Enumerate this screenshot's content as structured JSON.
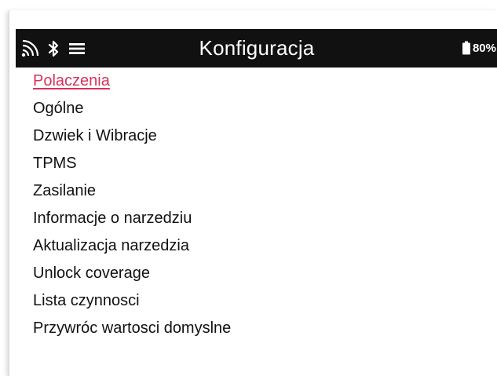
{
  "app": {
    "title": "Konfiguracja"
  },
  "status_bar": {
    "icons": [
      "signal-icon",
      "bluetooth-icon",
      "menu-icon"
    ],
    "battery_label": "80%",
    "battery_level_percent": 80
  },
  "menu": {
    "selected_index": 0,
    "items": [
      {
        "label": "Polaczenia"
      },
      {
        "label": "Ogólne"
      },
      {
        "label": "Dzwiek i Wibracje"
      },
      {
        "label": "TPMS"
      },
      {
        "label": "Zasilanie"
      },
      {
        "label": "Informacje o narzedziu"
      },
      {
        "label": "Aktualizacja narzedzia"
      },
      {
        "label": "Unlock coverage"
      },
      {
        "label": "Lista czynnosci"
      },
      {
        "label": "Przywróc wartosci domyslne"
      }
    ]
  },
  "colors": {
    "header_background": "#111111",
    "selected_text": "#d9315a",
    "text": "#111111"
  }
}
